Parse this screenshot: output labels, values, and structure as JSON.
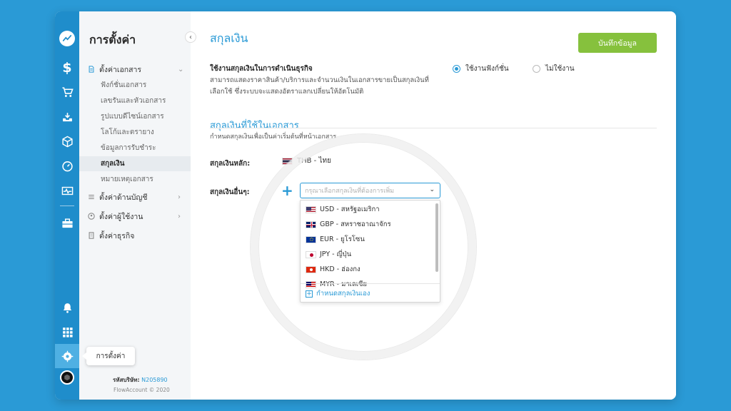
{
  "sidebar": {
    "title": "การตั้งค่า",
    "groups": [
      {
        "label": "ตั้งค่าเอกสาร",
        "icon": "document-icon",
        "expanded": true
      },
      {
        "label": "ตั้งค่าด้านบัญชี",
        "icon": "list-icon"
      },
      {
        "label": "ตั้งค่าผู้ใช้งาน",
        "icon": "user-icon"
      },
      {
        "label": "ตั้งค่าธุรกิจ",
        "icon": "building-icon"
      }
    ],
    "document_items": [
      "ฟังก์ชั่นเอกสาร",
      "เลขรันและหัวเอกสาร",
      "รูปแบบดีไซน์เอกสาร",
      "โลโก้และตรายาง",
      "ข้อมูลการรับชำระ",
      "สกุลเงิน",
      "หมายเหตุเอกสาร"
    ],
    "active_item": "สกุลเงิน",
    "company_code_label": "รหัสบริษัท:",
    "company_code": "N205890",
    "copyright": "FlowAccount © 2020"
  },
  "rail": {
    "icons": [
      "trend-icon",
      "dollar-icon",
      "cart-icon",
      "inbox-icon",
      "box-icon",
      "gauge-icon",
      "pulse-icon",
      "briefcase-icon",
      "bell-icon",
      "grid-icon",
      "gear-icon"
    ],
    "active": "gear-icon"
  },
  "tooltip": {
    "label": "การตั้งค่า"
  },
  "main": {
    "title": "สกุลเงิน",
    "save_label": "บันทึกข้อมูล",
    "section": {
      "label": "ใช้งานสกุลเงินในการดำเนินธุรกิจ",
      "desc": "สามารถแสดงราคาสินค้า/บริการและจำนวนเงินในเอกสารขายเป็นสกุลเงินที่เลือกใช้ ซึ่งระบบจะแสดงอัตราแลกเปลี่ยนให้อัตโนมัติ",
      "radio_on": "ใช้งานฟังก์ชั่น",
      "radio_off": "ไม่ใช้งาน",
      "selected": "on"
    },
    "currency": {
      "title": "สกุลเงินที่ใช้ในเอกสาร",
      "desc": "กำหนดสกุลเงินเพื่อเป็นค่าเริ่มต้นที่หน้าเอกสาร",
      "main_label": "สกุลเงินหลัก:",
      "main_value": "THB - ไทย",
      "other_label": "สกุลเงินอื่นๆ:",
      "select_placeholder": "กรุณาเลือกสกุลเงินที่ต้องการเพิ่ม",
      "options": [
        {
          "code": "USD - สหรัฐอเมริกา",
          "flag": "us-flag-icon"
        },
        {
          "code": "GBP - สหราชอาณาจักร",
          "flag": "uk-flag-icon"
        },
        {
          "code": "EUR - ยูโรโซน",
          "flag": "eu-flag-icon"
        },
        {
          "code": "JPY - ญี่ปุ่น",
          "flag": "jp-flag-icon"
        },
        {
          "code": "HKD - ฮ่องกง",
          "flag": "hk-flag-icon"
        },
        {
          "code": "MYR - มาเลเซีย",
          "flag": "my-flag-icon"
        }
      ],
      "custom_label": "กำหนดสกุลเงินเอง"
    }
  },
  "colors": {
    "brand": "#2a9ad6",
    "save": "#86c13d",
    "rail": "#1f8dcb"
  }
}
